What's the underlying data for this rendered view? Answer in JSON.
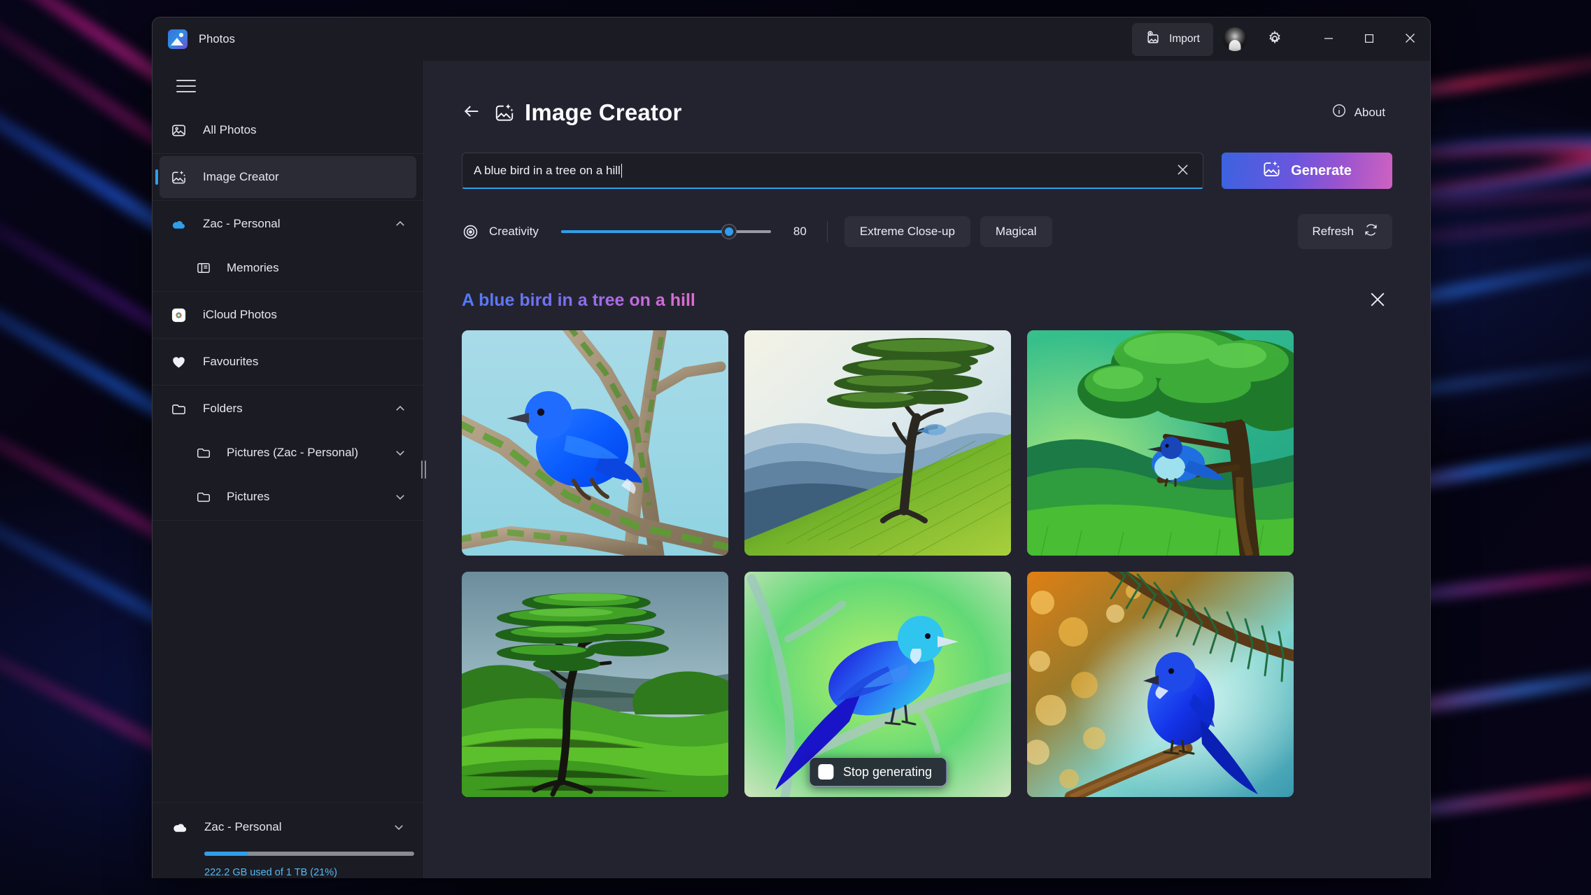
{
  "window": {
    "app_title": "Photos",
    "app_icon": "photos-app-icon",
    "titlebar": {
      "import_label": "Import",
      "import_icon": "import-image-icon",
      "avatar_icon": "user-avatar",
      "settings_icon": "gear-icon",
      "minimize_icon": "minimize-icon",
      "maximize_icon": "maximize-icon",
      "close_icon": "close-icon"
    }
  },
  "sidebar": {
    "hamburger_icon": "hamburger-menu-icon",
    "items": [
      {
        "label": "All Photos",
        "icon": "photo-icon",
        "selected": false,
        "chevron": "",
        "indent": false
      },
      {
        "label": "Image Creator",
        "icon": "image-creator-icon",
        "selected": true,
        "chevron": "",
        "indent": false
      },
      {
        "label": "Zac - Personal",
        "icon": "onedrive-icon",
        "selected": false,
        "chevron": "up",
        "indent": false
      },
      {
        "label": "Memories",
        "icon": "memories-icon",
        "selected": false,
        "chevron": "",
        "indent": true
      },
      {
        "label": "iCloud Photos",
        "icon": "icloud-photos-icon",
        "selected": false,
        "chevron": "",
        "indent": false
      },
      {
        "label": "Favourites",
        "icon": "heart-icon",
        "selected": false,
        "chevron": "",
        "indent": false
      },
      {
        "label": "Folders",
        "icon": "folder-icon",
        "selected": false,
        "chevron": "up",
        "indent": false
      },
      {
        "label": "Pictures (Zac - Personal)",
        "icon": "folder-icon",
        "selected": false,
        "chevron": "down",
        "indent": true
      },
      {
        "label": "Pictures",
        "icon": "folder-icon",
        "selected": false,
        "chevron": "down",
        "indent": true
      }
    ],
    "storage": {
      "account_label": "Zac - Personal",
      "account_icon": "cloud-icon",
      "chevron": "down",
      "used_text": "222.2 GB used of 1 TB (21%)",
      "percent": 21,
      "bar_color": "#2f9fea",
      "text_color": "#56b8f0"
    },
    "resize_grip": "sidebar-resize-grip"
  },
  "main": {
    "back_icon": "back-arrow-icon",
    "title_icon": "image-creator-icon",
    "title": "Image Creator",
    "about_label": "About",
    "about_icon": "info-icon",
    "prompt": {
      "value": "A blue bird in a tree on a hill",
      "placeholder": "Describe the image you want to create",
      "clear_icon": "clear-x-icon",
      "accent_color": "#2f9fea"
    },
    "generate": {
      "label": "Generate",
      "icon": "image-creator-icon",
      "gradient_from": "#3b63e0",
      "gradient_to": "#cf62c0"
    },
    "creativity": {
      "icon": "creativity-target-icon",
      "label": "Creativity",
      "value": 80,
      "min": 0,
      "max": 100
    },
    "chips": [
      {
        "label": "Extreme Close-up"
      },
      {
        "label": "Magical"
      }
    ],
    "refresh": {
      "label": "Refresh",
      "icon": "refresh-icon"
    },
    "results": {
      "title": "A blue bird in a tree on a hill",
      "close_icon": "close-results-icon",
      "tiles": [
        {
          "alt": "Blue bird perched on mossy tree branch against pale blue sky",
          "scene": "bird-branch-closeup"
        },
        {
          "alt": "Lone windswept tree on a green hillside with blue mountains",
          "scene": "lone-tree-hills-misty"
        },
        {
          "alt": "Blue bird on a branch of a big green tree over grassy hills",
          "scene": "bird-green-tree"
        },
        {
          "alt": "Lone green canopy tree on rolling green hills",
          "scene": "lone-tree-rolling-hills"
        },
        {
          "alt": "Blue jay on a branch against a bright green background",
          "scene": "bluejay-green"
        },
        {
          "alt": "Blue bird on a pine branch with warm golden bokeh",
          "scene": "bird-pine-bokeh"
        }
      ],
      "stop_generating": {
        "label": "Stop generating",
        "icon": "stop-square-icon",
        "on_tile_index": 4
      }
    }
  }
}
